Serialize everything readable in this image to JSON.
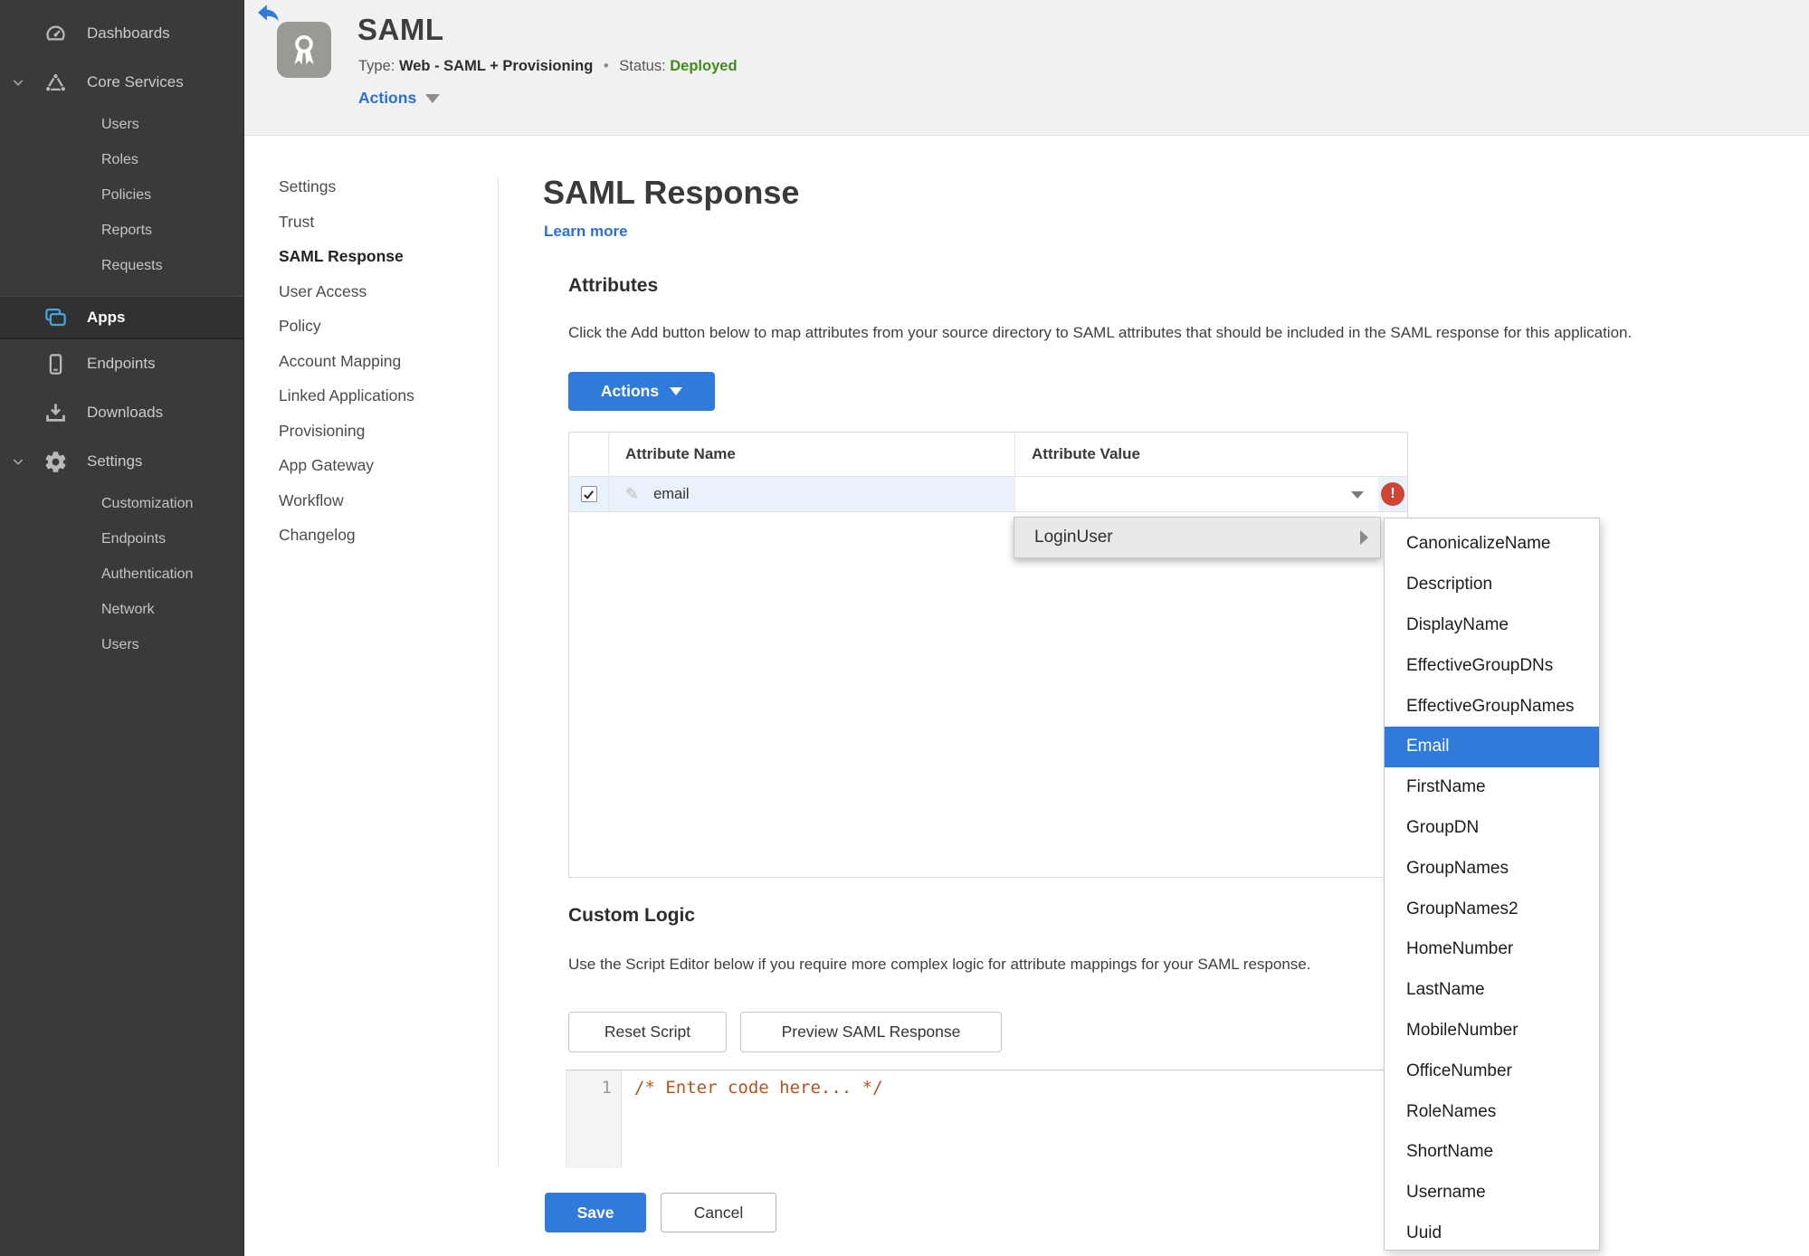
{
  "sidebar": {
    "items": [
      {
        "label": "Dashboards"
      },
      {
        "label": "Core Services"
      },
      {
        "label": "Users"
      },
      {
        "label": "Roles"
      },
      {
        "label": "Policies"
      },
      {
        "label": "Reports"
      },
      {
        "label": "Requests"
      },
      {
        "label": "Apps",
        "active": true
      },
      {
        "label": "Endpoints"
      },
      {
        "label": "Downloads"
      },
      {
        "label": "Settings"
      },
      {
        "label": "Customization"
      },
      {
        "label": "Endpoints"
      },
      {
        "label": "Authentication"
      },
      {
        "label": "Network"
      },
      {
        "label": "Users"
      }
    ]
  },
  "header": {
    "app_title": "SAML",
    "type_label": "Type:",
    "type_value": "Web - SAML + Provisioning",
    "separator": "•",
    "status_label": "Status:",
    "status_value": "Deployed",
    "actions_label": "Actions"
  },
  "subnav": {
    "items": [
      {
        "label": "Settings"
      },
      {
        "label": "Trust"
      },
      {
        "label": "SAML Response",
        "active": true
      },
      {
        "label": "User Access"
      },
      {
        "label": "Policy"
      },
      {
        "label": "Account Mapping"
      },
      {
        "label": "Linked Applications"
      },
      {
        "label": "Provisioning"
      },
      {
        "label": "App Gateway"
      },
      {
        "label": "Workflow"
      },
      {
        "label": "Changelog"
      }
    ]
  },
  "main": {
    "title": "SAML Response",
    "learn_more": "Learn more",
    "attributes": {
      "heading": "Attributes",
      "description": "Click the Add button below to map attributes from your source directory to SAML attributes that should be included in the SAML response for this application.",
      "actions_button": "Actions",
      "table": {
        "columns": [
          "Attribute Name",
          "Attribute Value"
        ],
        "row": {
          "name": "email",
          "checked": true,
          "value": "",
          "error": "!"
        }
      }
    },
    "value_menu": {
      "label": "LoginUser",
      "selected_option": "Email",
      "options": [
        {
          "label": "CanonicalizeName"
        },
        {
          "label": "Description"
        },
        {
          "label": "DisplayName"
        },
        {
          "label": "EffectiveGroupDNs"
        },
        {
          "label": "EffectiveGroupNames"
        },
        {
          "label": "Email",
          "active": true
        },
        {
          "label": "FirstName"
        },
        {
          "label": "GroupDN"
        },
        {
          "label": "GroupNames"
        },
        {
          "label": "GroupNames2"
        },
        {
          "label": "HomeNumber"
        },
        {
          "label": "LastName"
        },
        {
          "label": "MobileNumber"
        },
        {
          "label": "OfficeNumber"
        },
        {
          "label": "RoleNames"
        },
        {
          "label": "ShortName"
        },
        {
          "label": "Username"
        },
        {
          "label": "Uuid"
        }
      ]
    },
    "custom_logic": {
      "heading": "Custom Logic",
      "description": "Use the Script Editor below if you require more complex logic for attribute mappings for your SAML response.",
      "reset_button": "Reset Script",
      "preview_button": "Preview SAML Response",
      "editor": {
        "line_number": "1",
        "code": "/* Enter code here... */"
      }
    },
    "footer": {
      "save": "Save",
      "cancel": "Cancel"
    }
  },
  "colors": {
    "accent_blue": "#2f7bd9",
    "link_blue": "#2b6fd3",
    "status_green": "#438a1e",
    "error_red": "#ce4435",
    "row_highlight": "#e9f1fb",
    "sidebar_bg": "#3a3a3a"
  }
}
